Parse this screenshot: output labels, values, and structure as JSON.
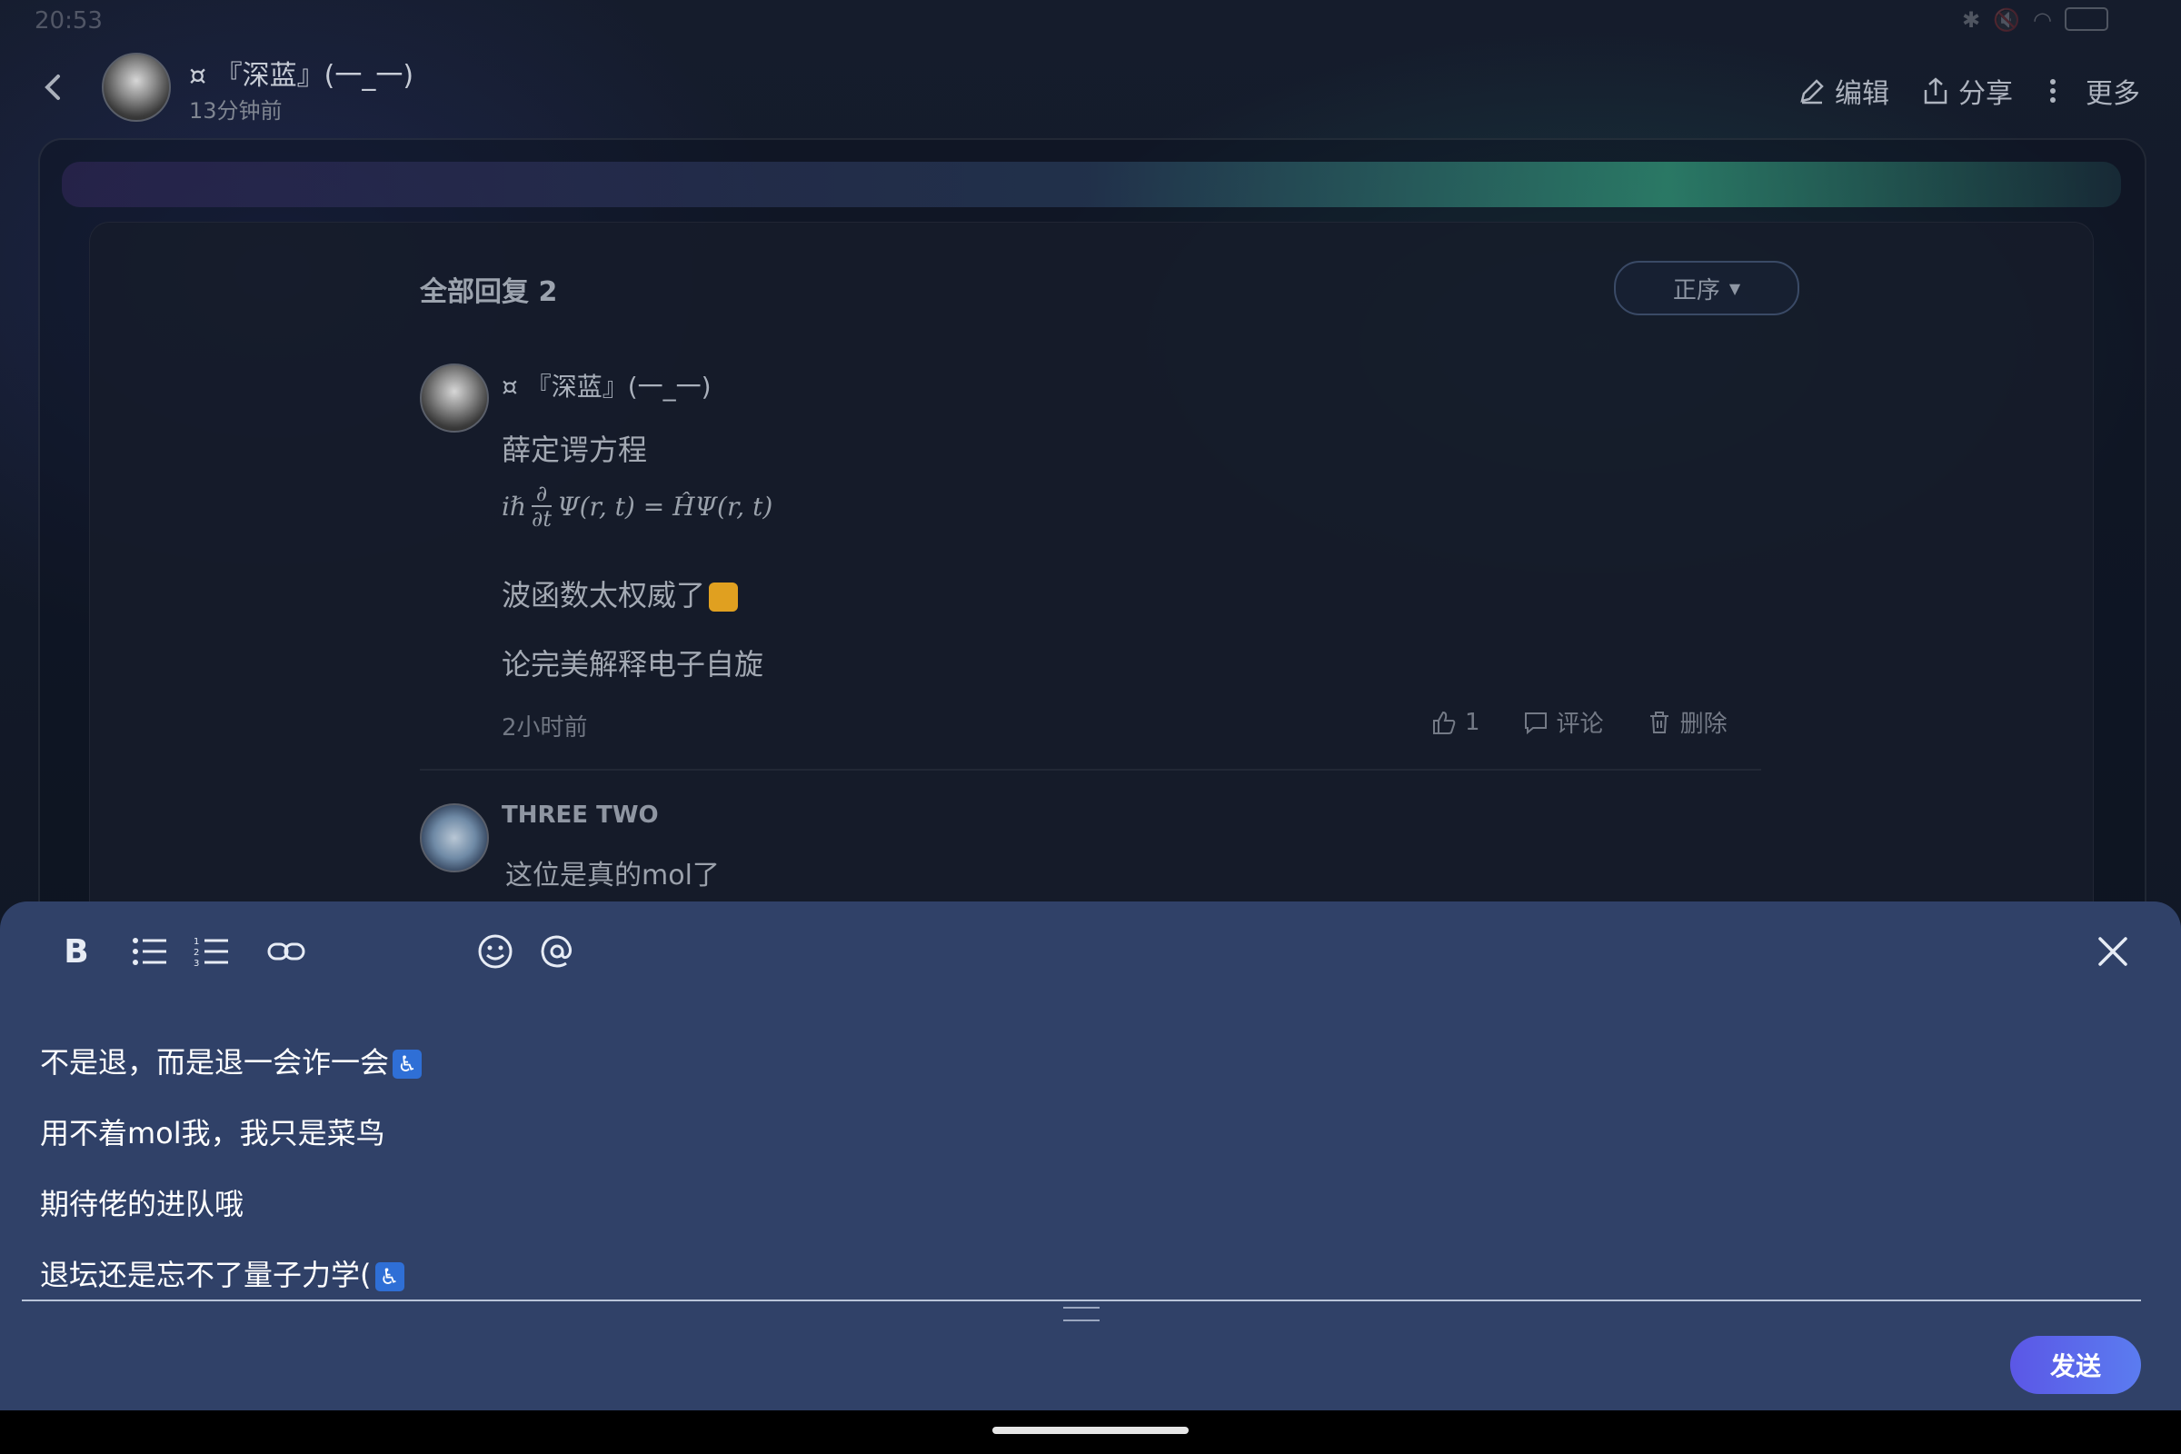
{
  "status": {
    "time": "20:53",
    "icons": [
      "bluetooth-icon",
      "mute-icon",
      "wifi-icon",
      "battery-icon"
    ]
  },
  "header": {
    "author": "¤ 『深蓝』(一_一)",
    "time": "13分钟前",
    "actions": [
      {
        "label": "编辑",
        "icon": "edit-icon"
      },
      {
        "label": "分享",
        "icon": "share-icon"
      },
      {
        "label": "更多",
        "icon": "more-icon"
      }
    ]
  },
  "replies": {
    "title": "全部回复 2",
    "sort_label": "正序",
    "items": [
      {
        "author": "¤ 『深蓝』(一_一)",
        "lines": [
          "薛定谔方程",
          "波函数太权威了",
          "论完美解释电子自旋"
        ],
        "formula": {
          "prefix": "iℏ",
          "num": "∂",
          "den": "∂t",
          "rest": "Ψ(r, t) = ĤΨ(r, t)"
        },
        "time": "2小时前",
        "like_count": "1",
        "comment_label": "评论",
        "delete_label": "删除"
      },
      {
        "author": "THREE TWO",
        "text": "这位是真的mol了"
      }
    ]
  },
  "editor": {
    "toolbar": [
      "bold",
      "bullet-list",
      "numbered-list",
      "link",
      "emoji",
      "mention"
    ],
    "lines": [
      "不是退，而是退一会诈一会",
      "用不着mol我，我只是菜鸟",
      "期待佬的进队哦",
      "退坛还是忘不了量子力学("
    ],
    "send_label": "发送"
  },
  "colors": {
    "editor_bg": "#304168",
    "send_start": "#5b57e6",
    "send_end": "#5b7cf0"
  }
}
